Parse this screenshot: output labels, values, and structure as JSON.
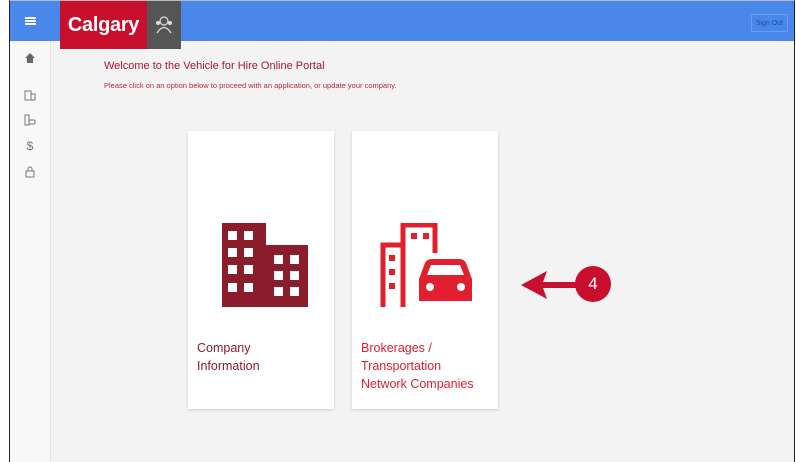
{
  "header": {
    "brand": "Calgary",
    "signout_label": "Sign Out"
  },
  "sidenav": {
    "items": [
      {
        "icon": "home-icon"
      },
      {
        "icon": "company-icon"
      },
      {
        "icon": "vehicle-icon"
      },
      {
        "icon": "dollar-icon"
      },
      {
        "icon": "lock-icon"
      }
    ]
  },
  "main": {
    "welcome": "Welcome to the Vehicle for Hire Online Portal",
    "instructions": "Please click on an option below to proceed with an application, or update your company.",
    "cards": [
      {
        "title": "Company\nInformation",
        "icon": "building-icon",
        "color": "#8b1c2c"
      },
      {
        "title": "Brokerages /\nTransportation\nNetwork Companies",
        "icon": "building-car-icon",
        "color": "#e0202e"
      }
    ],
    "callout_number": "4"
  },
  "colors": {
    "topbar": "#4a87eb",
    "brand_red": "#c8102e",
    "callout": "#c8102e"
  }
}
